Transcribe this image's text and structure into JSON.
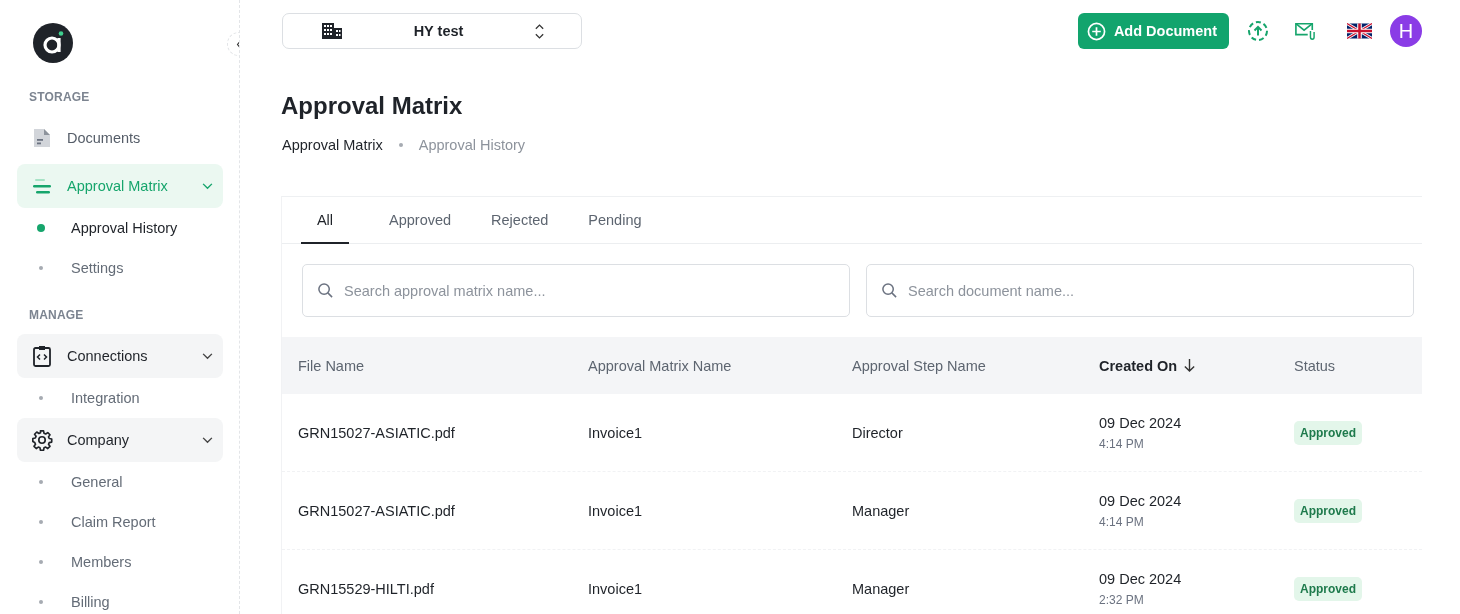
{
  "sidebar": {
    "sections": [
      {
        "heading": "STORAGE",
        "items": [
          {
            "label": "Documents",
            "kind": "link",
            "selected": false
          },
          {
            "label": "Approval Matrix",
            "kind": "group",
            "selected": true,
            "expanded": true,
            "children": [
              {
                "label": "Approval History",
                "selected": true
              },
              {
                "label": "Settings",
                "selected": false
              }
            ]
          }
        ]
      },
      {
        "heading": "MANAGE",
        "items": [
          {
            "label": "Connections",
            "kind": "group",
            "selected": false,
            "expanded": true,
            "children": [
              {
                "label": "Integration",
                "selected": false
              }
            ]
          },
          {
            "label": "Company",
            "kind": "group",
            "selected": false,
            "expanded": true,
            "children": [
              {
                "label": "General",
                "selected": false
              },
              {
                "label": "Claim Report",
                "selected": false
              },
              {
                "label": "Members",
                "selected": false
              },
              {
                "label": "Billing",
                "selected": false
              }
            ]
          }
        ]
      }
    ]
  },
  "topbar": {
    "workspace": "HY test",
    "add_button": "Add Document",
    "avatar": "H"
  },
  "page": {
    "title": "Approval Matrix",
    "breadcrumbs": [
      "Approval Matrix",
      "Approval History"
    ]
  },
  "tabs": [
    {
      "label": "All",
      "selected": true
    },
    {
      "label": "Approved",
      "selected": false
    },
    {
      "label": "Rejected",
      "selected": false
    },
    {
      "label": "Pending",
      "selected": false
    }
  ],
  "searches": [
    {
      "placeholder": "Search approval matrix name..."
    },
    {
      "placeholder": "Search document name..."
    }
  ],
  "table": {
    "columns": [
      {
        "label": "File Name",
        "sorted": false
      },
      {
        "label": "Approval Matrix Name",
        "sorted": false
      },
      {
        "label": "Approval Step Name",
        "sorted": false
      },
      {
        "label": "Created On",
        "sorted": true
      },
      {
        "label": "Status",
        "sorted": false
      }
    ],
    "rows": [
      {
        "file": "GRN15027-ASIATIC.pdf",
        "matrix": "Invoice1",
        "step": "Director",
        "date": "09 Dec 2024",
        "time": "4:14 PM",
        "status": {
          "label": "Approved",
          "kind": "approved"
        }
      },
      {
        "file": "GRN15027-ASIATIC.pdf",
        "matrix": "Invoice1",
        "step": "Manager",
        "date": "09 Dec 2024",
        "time": "4:14 PM",
        "status": {
          "label": "Approved",
          "kind": "approved"
        }
      },
      {
        "file": "GRN15529-HILTI.pdf",
        "matrix": "Invoice1",
        "step": "Manager",
        "date": "09 Dec 2024",
        "time": "2:32 PM",
        "status": {
          "label": "Approved",
          "kind": "approved"
        }
      }
    ]
  }
}
